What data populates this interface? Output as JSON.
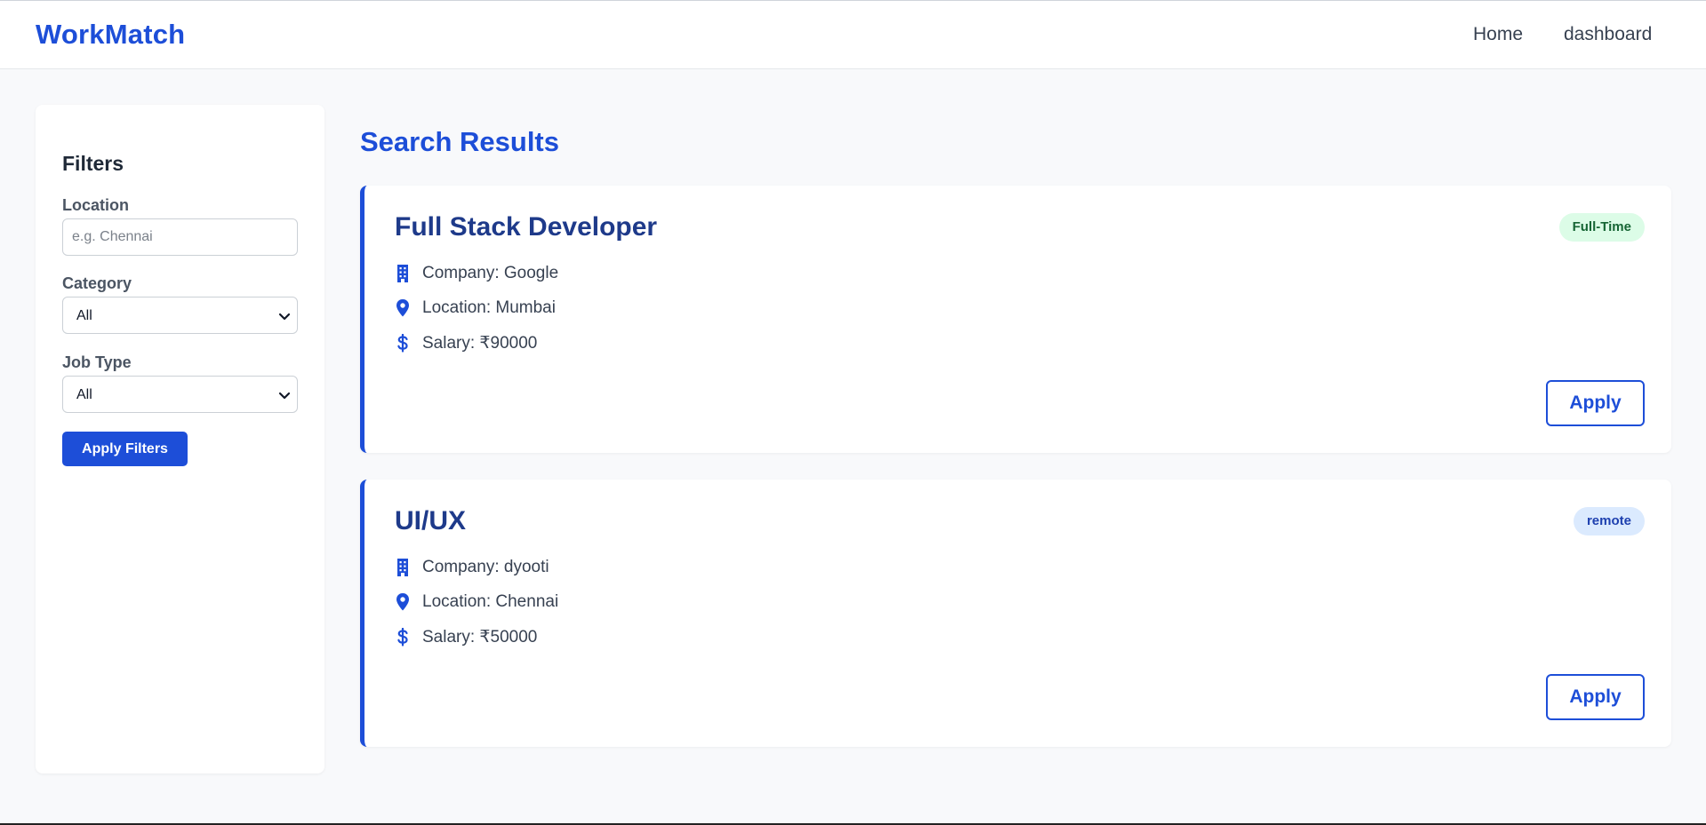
{
  "brand": "WorkMatch",
  "nav": {
    "home": "Home",
    "dashboard": "dashboard"
  },
  "filters": {
    "title": "Filters",
    "location_label": "Location",
    "location_placeholder": "e.g. Chennai",
    "location_value": "",
    "category_label": "Category",
    "category_value": "All",
    "job_type_label": "Job Type",
    "job_type_value": "All",
    "apply_label": "Apply Filters"
  },
  "results": {
    "title": "Search Results",
    "jobs": [
      {
        "title": "Full Stack Developer",
        "badge": "Full-Time",
        "company": "Company: Google",
        "location": "Location: Mumbai",
        "salary": "Salary: ₹90000",
        "apply_label": "Apply"
      },
      {
        "title": "UI/UX",
        "badge": "remote",
        "company": "Company: dyooti",
        "location": "Location: Chennai",
        "salary": "Salary: ₹50000",
        "apply_label": "Apply"
      }
    ]
  },
  "colors": {
    "accent": "#1d4ed8",
    "title_dark": "#1e3a8a",
    "badge_fulltime_bg": "#dcfce7",
    "badge_remote_bg": "#dbeafe"
  },
  "icons": {
    "company": "building-icon",
    "location": "map-pin-icon",
    "salary": "dollar-icon",
    "select": "chevron-down-icon"
  }
}
